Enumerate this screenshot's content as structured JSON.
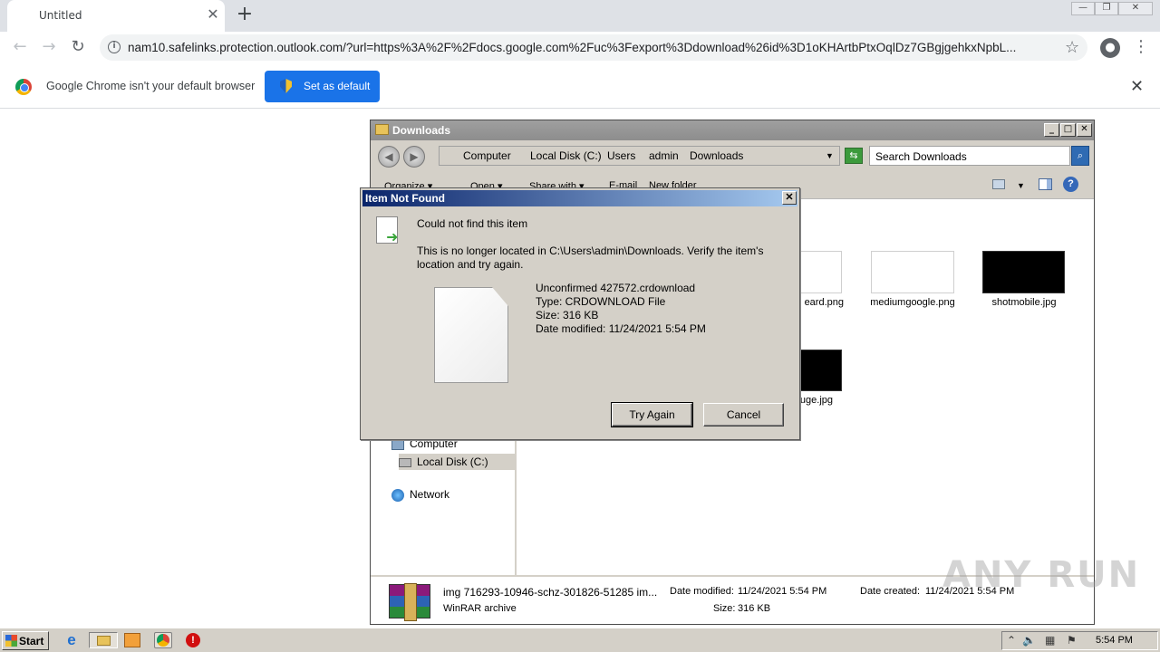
{
  "browser": {
    "tab_title": "Untitled",
    "tab_close": "✕",
    "new_tab": "+",
    "url": "nam10.safelinks.protection.outlook.com/?url=https%3A%2F%2Fdocs.google.com%2Fuc%3Fexport%3Ddownload%26id%3D1oKHArtbPtxOqlDz7GBgjgehkxNpbL...",
    "infobar_message": "Google Chrome isn't your default browser",
    "set_default_label": "Set as default",
    "icons": [
      "back-icon",
      "forward-icon",
      "reload-icon",
      "site-info-icon",
      "star-icon",
      "account-icon",
      "menu-icon",
      "close-icon"
    ]
  },
  "explorer": {
    "title": "Downloads",
    "breadcrumb": [
      "Computer",
      "Local Disk (C:)",
      "Users",
      "admin",
      "Downloads"
    ],
    "search_placeholder": "Search Downloads",
    "commands": [
      "Organize ▾",
      "Open ▾",
      "Share with ▾",
      "E-mail",
      "New folder"
    ],
    "nav_tree": {
      "computer": "Computer",
      "local_disk": "Local Disk (C:)",
      "network": "Network"
    },
    "files": [
      {
        "name": "eard.png"
      },
      {
        "name": "mediumgoogle.png"
      },
      {
        "name": "shotmobile.jpg"
      },
      {
        "name": "uge.jpg"
      }
    ],
    "details": {
      "name": "img 716293-10946-schz-301826-51285 im...",
      "type": "WinRAR archive",
      "date_modified_label": "Date modified:",
      "date_modified": "11/24/2021 5:54 PM",
      "size_label": "Size:",
      "size": "316 KB",
      "date_created_label": "Date created:",
      "date_created": "11/24/2021 5:54 PM"
    }
  },
  "dialog": {
    "title": "Item Not Found",
    "heading": "Could not find this item",
    "message": "This is no longer located in C:\\Users\\admin\\Downloads. Verify the item's location and try again.",
    "file_name": "Unconfirmed 427572.crdownload",
    "file_type": "Type: CRDOWNLOAD File",
    "file_size": "Size: 316 KB",
    "file_date": "Date modified: 11/24/2021 5:54 PM",
    "try_again": "Try Again",
    "cancel": "Cancel"
  },
  "taskbar": {
    "start": "Start",
    "clock": "5:54 PM"
  },
  "watermark": "ANY RUN"
}
